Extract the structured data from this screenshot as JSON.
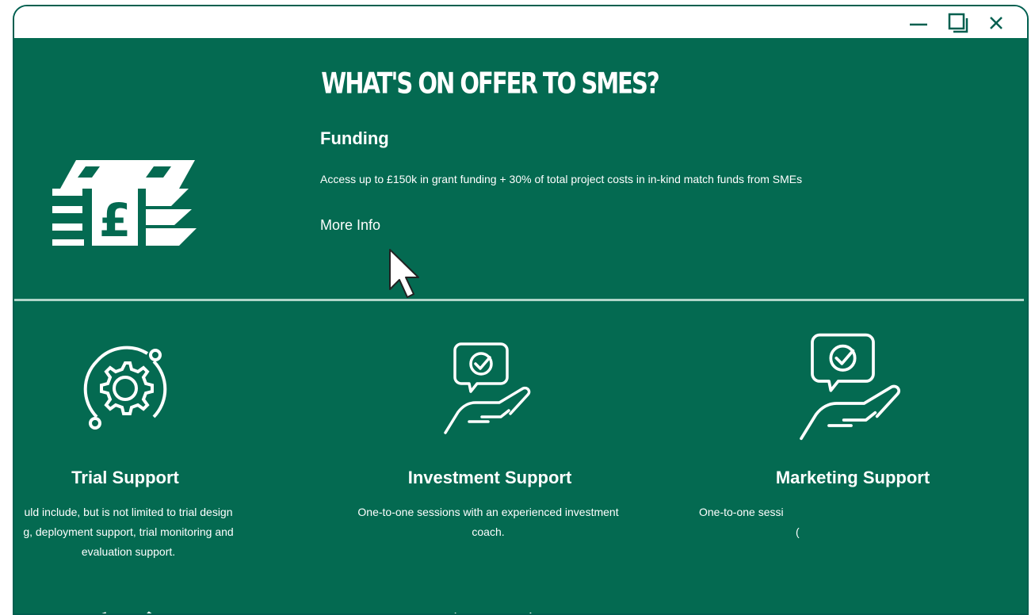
{
  "window": {
    "controls": {
      "minimize_icon": "minimize-icon",
      "maximize_icon": "maximize-icon",
      "close_icon": "close-icon"
    }
  },
  "page": {
    "heading": "WHAT'S ON OFFER TO SMES?",
    "funding": {
      "title": "Funding",
      "description": "Access up to £150k in grant funding + 30% of total project costs in in-kind match funds from SMEs",
      "link_label": "More Info",
      "icon": "money-stack-pound-icon"
    },
    "cards": [
      {
        "title": "Trial Support",
        "icon": "gear-icon",
        "description_lines": [
          "uld include, but is not limited to trial design",
          "g, deployment support, trial monitoring and",
          "evaluation support."
        ]
      },
      {
        "title": "Investment Support",
        "icon": "hand-check-icon",
        "description_lines": [
          "One-to-one sessions with an experienced investment",
          "coach."
        ]
      },
      {
        "title": "Marketing Support",
        "icon": "hand-check-icon",
        "description_lines": [
          "One-to-one sessi",
          "("
        ]
      }
    ],
    "colors": {
      "background": "#046a51",
      "text": "#ffffff",
      "window_border": "#005f4f"
    }
  }
}
